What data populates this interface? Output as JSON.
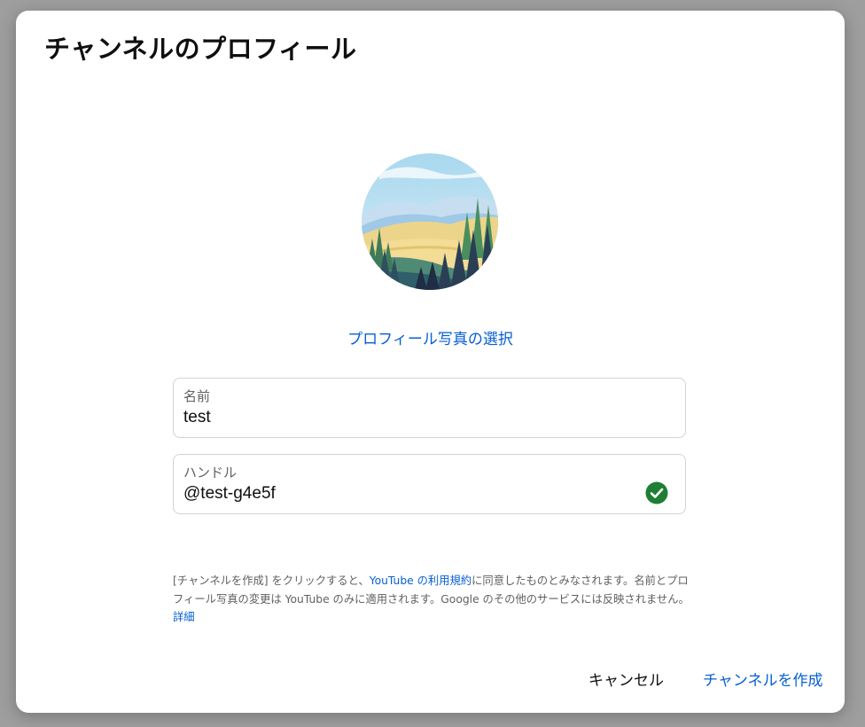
{
  "dialog": {
    "title": "チャンネルのプロフィール"
  },
  "avatar": {
    "icon": "landscape-illustration"
  },
  "choose_photo_label": "プロフィール写真の選択",
  "name_field": {
    "label": "名前",
    "value": "test"
  },
  "handle_field": {
    "label": "ハンドル",
    "value": "@test-g4e5f",
    "status_icon": "check-circle-icon",
    "status_color": "#1e7e34"
  },
  "legal": {
    "part1": "[チャンネルを作成] をクリックすると、",
    "terms_link": "YouTube の利用規約",
    "part2": "に同意したものとみなされます。名前とプロフィール写真の変更は YouTube のみに適用されます。Google のその他のサービスには反映されません。 ",
    "learn_more": "詳細"
  },
  "actions": {
    "cancel_label": "キャンセル",
    "create_label": "チャンネルを作成"
  },
  "colors": {
    "link": "#065fd4",
    "backdrop": "#9e9e9e"
  }
}
